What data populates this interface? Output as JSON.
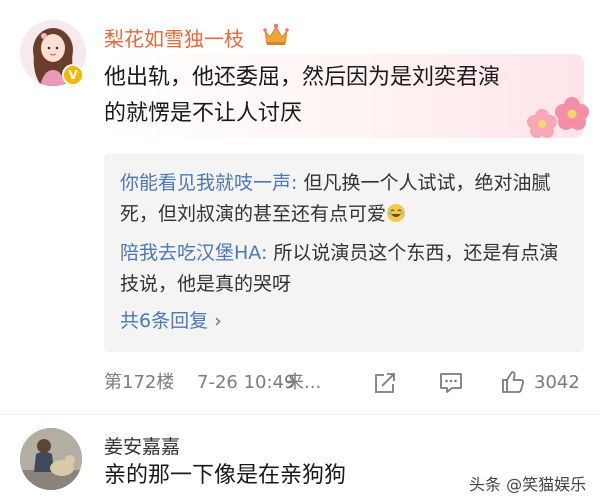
{
  "comment": {
    "username": "梨花如雪独一枝",
    "text_line1": "他出轨，他还委屈，然后因为是刘奕君演",
    "text_line2": "的就愣是不让人讨厌",
    "replies": [
      {
        "username": "你能看见我就吱一声:",
        "text": " 但凡换一个人试试，绝对油腻死，但刘叔演的甚至还有点可爱"
      },
      {
        "username": "陪我去吃汉堡HA:",
        "text": " 所以说演员这个东西，还是有点演技说，他是真的哭呀"
      }
    ],
    "more_replies": "共6条回复 ›",
    "floor": "第172楼",
    "date": "7-26 10:49",
    "source": "来...",
    "likes": "3042"
  },
  "comment2": {
    "username": "姜安嘉嘉",
    "text": "亲的那一下像是在亲狗狗"
  },
  "watermark": "头条 @笑猫娱乐",
  "colors": {
    "username_orange": "#e8683a",
    "link_blue": "#4d78b6",
    "vip_badge": "#f5b800",
    "meta_gray": "#7c7c7c"
  },
  "icons": [
    "crown-icon",
    "verified-badge-icon",
    "flower-sticker-icon",
    "laugh-emoji-icon",
    "share-icon",
    "comment-icon",
    "like-icon",
    "chevron-right-icon"
  ]
}
